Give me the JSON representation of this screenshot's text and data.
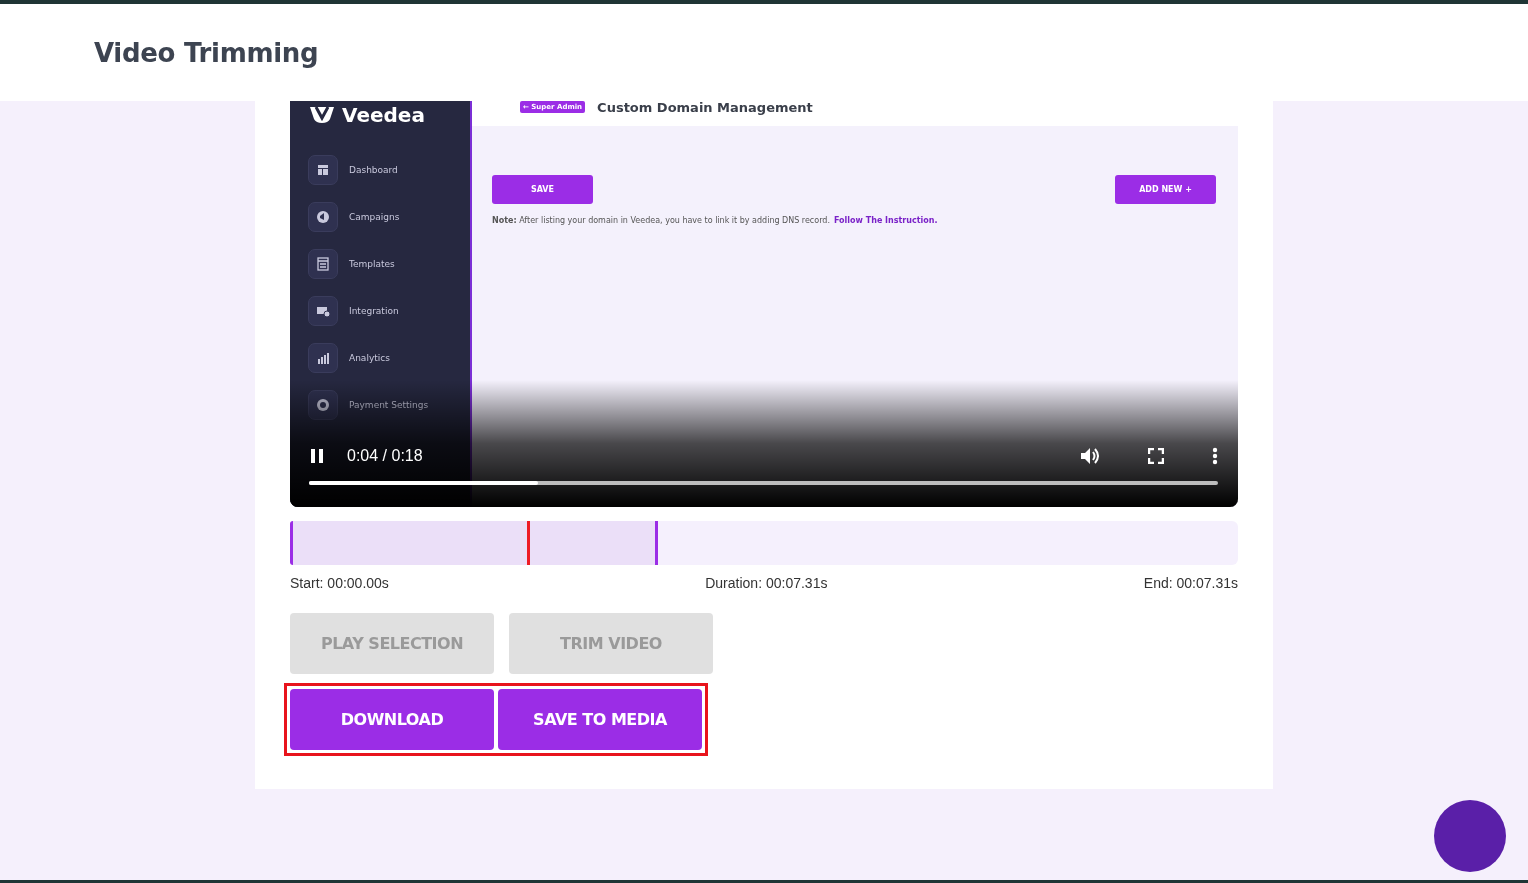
{
  "page": {
    "title": "Video Trimming"
  },
  "video": {
    "app": {
      "logo": "Veedea",
      "sidebar": [
        {
          "label": "Dashboard"
        },
        {
          "label": "Campaigns"
        },
        {
          "label": "Templates"
        },
        {
          "label": "Integration"
        },
        {
          "label": "Analytics"
        },
        {
          "label": "Payment Settings"
        }
      ],
      "back_button": "← Super Admin",
      "heading": "Custom Domain Management",
      "save_button": "SAVE",
      "add_button": "ADD NEW +",
      "note": "**Note:** After listing your domain in Veedea, you have to link it by adding DNS record.",
      "note_link": "Follow The Instruction."
    },
    "player": {
      "playing": true,
      "time": "0:04 / 0:18",
      "level": 0.252
    }
  },
  "trim": {
    "selection": {
      "level": 0.388
    },
    "playhead": {
      "level": 0.25
    },
    "start": "Start: 00:00.00s",
    "duration": "Duration: 00:07.31s",
    "end": "End: 00:07.31s"
  },
  "buttons": [
    {
      "label": "PLAY SELECTION",
      "disabled": true
    },
    {
      "label": "TRIM VIDEO",
      "disabled": true
    }
  ],
  "action_group": {
    "highlighted": true,
    "buttons": [
      {
        "label": "DOWNLOAD",
        "disabled": false
      },
      {
        "label": "SAVE TO MEDIA",
        "disabled": false
      }
    ]
  }
}
